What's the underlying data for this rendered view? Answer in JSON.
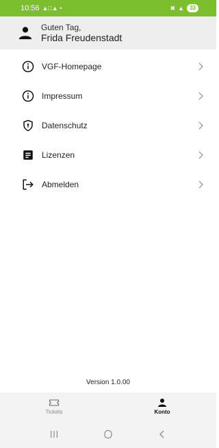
{
  "status_bar": {
    "time": "10:56",
    "battery": "33",
    "background_color": "#7cbf2e"
  },
  "header": {
    "greeting": "Guten Tag,",
    "user_name": "Frida Freudenstadt",
    "icon": "person-icon"
  },
  "menu": {
    "items": [
      {
        "label": "VGF-Homepage",
        "icon": "info-circle-icon"
      },
      {
        "label": "Impressum",
        "icon": "info-circle-icon"
      },
      {
        "label": "Datenschutz",
        "icon": "shield-icon"
      },
      {
        "label": "Lizenzen",
        "icon": "document-icon"
      },
      {
        "label": "Abmelden",
        "icon": "logout-icon"
      }
    ]
  },
  "version": "Version 1.0.00",
  "bottom_nav": {
    "tabs": [
      {
        "label": "Tickets",
        "icon": "ticket-icon",
        "active": false
      },
      {
        "label": "Konto",
        "icon": "person-icon",
        "active": true
      }
    ]
  }
}
